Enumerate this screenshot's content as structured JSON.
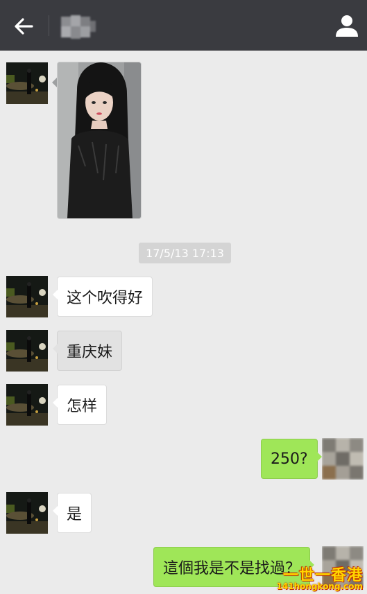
{
  "header": {
    "back_icon": "arrow-left-icon",
    "title_blurred": "",
    "profile_icon": "person-icon"
  },
  "messages": [
    {
      "side": "left",
      "type": "image",
      "content": "photo"
    },
    {
      "side": "center",
      "type": "timestamp",
      "text": "17/5/13 17:13"
    },
    {
      "side": "left",
      "type": "text",
      "text": "这个吹得好"
    },
    {
      "side": "left",
      "type": "text",
      "text": "重庆妹"
    },
    {
      "side": "left",
      "type": "text",
      "text": "怎样"
    },
    {
      "side": "right",
      "type": "text",
      "text": "250?"
    },
    {
      "side": "left",
      "type": "text",
      "text": "是"
    },
    {
      "side": "right",
      "type": "text",
      "text": "這個我是不是找過？"
    }
  ],
  "watermark": {
    "main": "一世一香港",
    "sub": "141hongkong.com"
  },
  "colors": {
    "topbar": "#3a3b40",
    "background": "#ebebeb",
    "bubble_incoming": "#ffffff",
    "bubble_outgoing": "#9fe658"
  }
}
